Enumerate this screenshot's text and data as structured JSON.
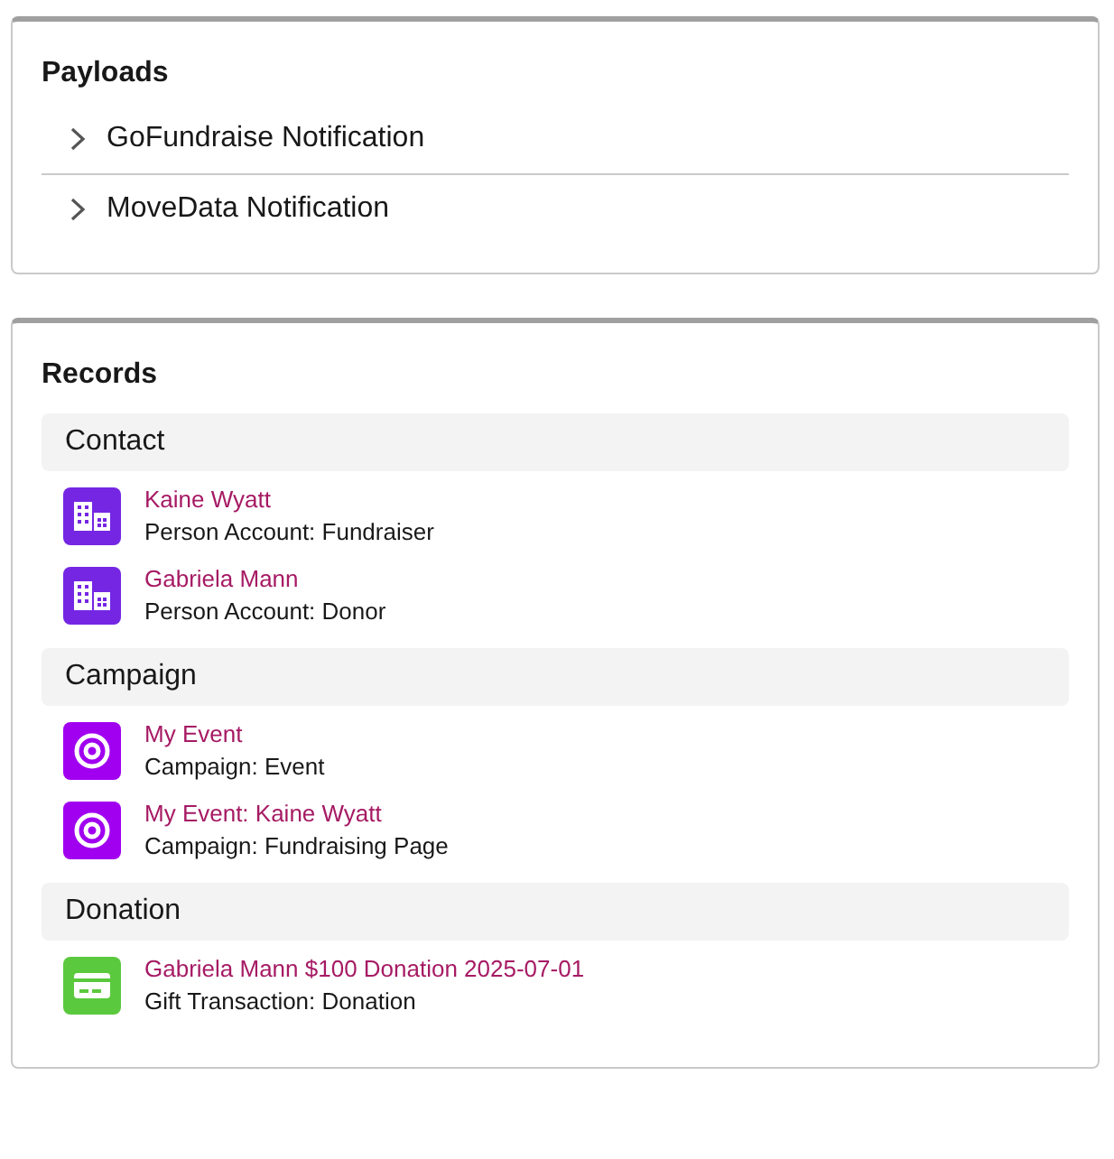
{
  "payloads": {
    "title": "Payloads",
    "items": [
      {
        "label": "GoFundraise Notification",
        "expanded": false
      },
      {
        "label": "MoveData Notification",
        "expanded": false
      }
    ]
  },
  "records": {
    "title": "Records",
    "groups": [
      {
        "label": "Contact",
        "items": [
          {
            "kind": "account",
            "name": "Kaine Wyatt",
            "type": "Person Account: Fundraiser"
          },
          {
            "kind": "account",
            "name": "Gabriela Mann",
            "type": "Person Account: Donor"
          }
        ]
      },
      {
        "label": "Campaign",
        "items": [
          {
            "kind": "campaign",
            "name": "My Event",
            "type": "Campaign: Event"
          },
          {
            "kind": "campaign",
            "name": "My Event: Kaine Wyatt",
            "type": "Campaign: Fundraising Page"
          }
        ]
      },
      {
        "label": "Donation",
        "items": [
          {
            "kind": "transaction",
            "name": "Gabriela Mann $100 Donation 2025-07-01",
            "type": "Gift Transaction: Donation"
          }
        ]
      }
    ]
  }
}
